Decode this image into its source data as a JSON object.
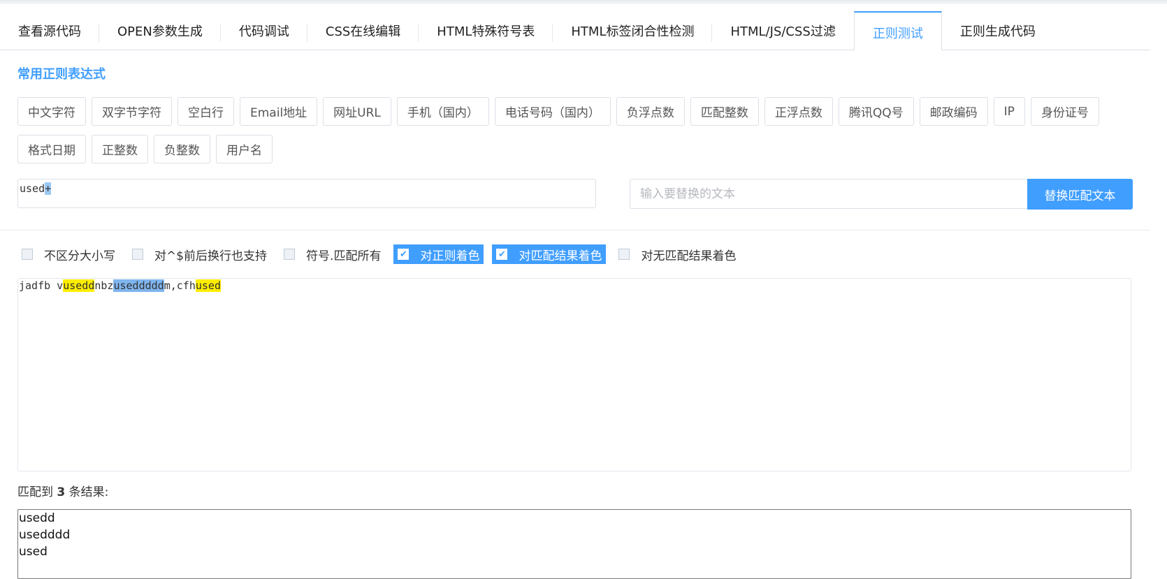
{
  "tabs": [
    {
      "label": "查看源代码",
      "active": false
    },
    {
      "label": "OPEN参数生成",
      "active": false
    },
    {
      "label": "代码调试",
      "active": false
    },
    {
      "label": "CSS在线编辑",
      "active": false
    },
    {
      "label": "HTML特殊符号表",
      "active": false
    },
    {
      "label": "HTML标签闭合性检测",
      "active": false
    },
    {
      "label": "HTML/JS/CSS过滤",
      "active": false
    },
    {
      "label": "正则测试",
      "active": true
    },
    {
      "label": "正则生成代码",
      "active": false
    }
  ],
  "section_title": "常用正则表达式",
  "presets": [
    "中文字符",
    "双字节字符",
    "空白行",
    "Email地址",
    "网址URL",
    "手机（国内）",
    "电话号码（国内）",
    "负浮点数",
    "匹配整数",
    "正浮点数",
    "腾讯QQ号",
    "邮政编码",
    "IP",
    "身份证号",
    "格式日期",
    "正整数",
    "负整数",
    "用户名"
  ],
  "regex": {
    "text_plain": "used",
    "text_highlight": "+"
  },
  "replace": {
    "placeholder": "输入要替换的文本",
    "value": "",
    "button_label": "替换匹配文本"
  },
  "options": [
    {
      "label": "不区分大小写",
      "checked": false
    },
    {
      "label": "对^$前后换行也支持",
      "checked": false
    },
    {
      "label": "符号.匹配所有",
      "checked": false
    },
    {
      "label": "对正则着色",
      "checked": true
    },
    {
      "label": "对匹配结果着色",
      "checked": true
    },
    {
      "label": "对无匹配结果着色",
      "checked": false
    }
  ],
  "test_text": {
    "segments": [
      {
        "text": "jadfb v",
        "mark": "none"
      },
      {
        "text": "usedd",
        "mark": "yellow"
      },
      {
        "text": "nbz",
        "mark": "none"
      },
      {
        "text": "useddddd",
        "mark": "blue"
      },
      {
        "text": "m,cfh",
        "mark": "none"
      },
      {
        "text": "used",
        "mark": "yellow"
      }
    ]
  },
  "result": {
    "prefix": "匹配到",
    "count": "3",
    "suffix": "条结果:",
    "items": [
      "usedd",
      "usedddd",
      "used"
    ]
  },
  "colors": {
    "accent": "#409eff",
    "match_yellow": "#ffee00",
    "match_blue": "#7fb5ef"
  }
}
